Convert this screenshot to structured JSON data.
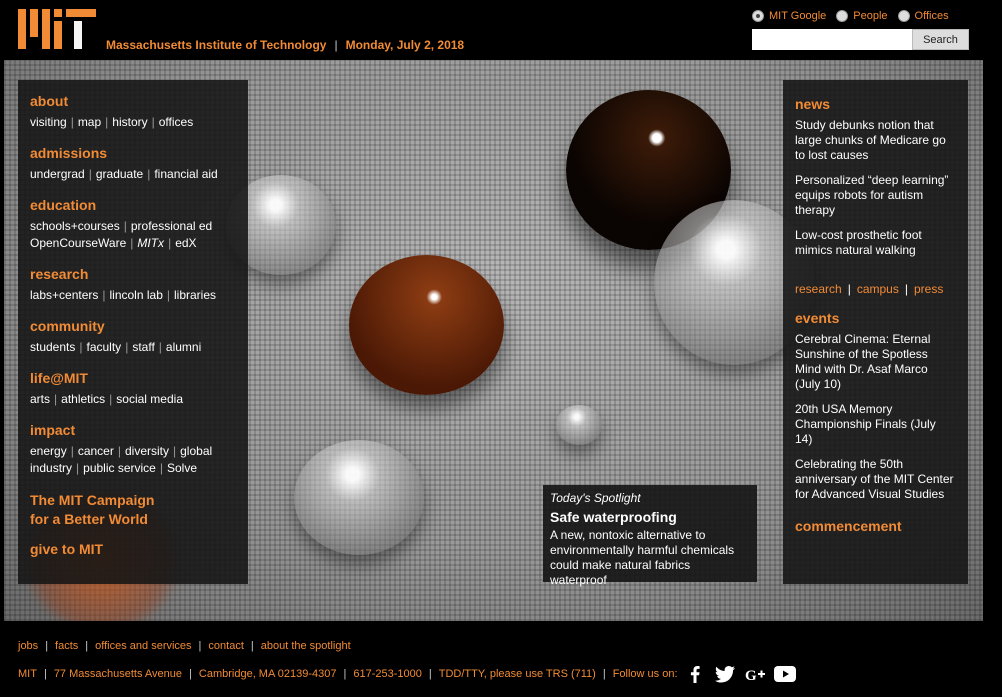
{
  "header": {
    "institute": "Massachusetts Institute of Technology",
    "date": "Monday, July 2, 2018"
  },
  "search": {
    "options": [
      "MIT Google",
      "People",
      "Offices"
    ],
    "selected": "MIT Google",
    "placeholder": "",
    "button_label": "Search"
  },
  "nav": {
    "about": {
      "heading": "about",
      "links": [
        "visiting",
        "map",
        "history",
        "offices"
      ]
    },
    "admissions": {
      "heading": "admissions",
      "links": [
        "undergrad",
        "graduate",
        "financial aid"
      ]
    },
    "education": {
      "heading": "education",
      "links": [
        "schools+courses",
        "professional ed",
        "OpenCourseWare",
        "MITx",
        "edX"
      ]
    },
    "research": {
      "heading": "research",
      "links": [
        "labs+centers",
        "lincoln lab",
        "libraries"
      ]
    },
    "community": {
      "heading": "community",
      "links": [
        "students",
        "faculty",
        "staff",
        "alumni"
      ]
    },
    "life": {
      "heading": "life@MIT",
      "links": [
        "arts",
        "athletics",
        "social media"
      ]
    },
    "impact": {
      "heading": "impact",
      "links": [
        "energy",
        "cancer",
        "diversity",
        "global",
        "industry",
        "public service",
        "Solve"
      ]
    },
    "campaign_line1": "The MIT Campaign",
    "campaign_line2": "for a Better World",
    "give": "give to MIT"
  },
  "news": {
    "heading": "news",
    "items": [
      "Study debunks notion that large chunks of Medicare go to lost causes",
      "Personalized “deep learning” equips robots for autism therapy",
      "Low-cost prosthetic foot mimics natural walking"
    ],
    "links": [
      "research",
      "campus",
      "press"
    ]
  },
  "events": {
    "heading": "events",
    "items": [
      "Cerebral Cinema: Eternal Sunshine of the Spotless Mind with Dr. Asaf Marco (July 10)",
      "20th USA Memory Championship Finals (July 14)",
      "Celebrating the 50th anniversary of the MIT Center for Advanced Visual Studies"
    ]
  },
  "commencement": "commencement",
  "spotlight": {
    "label": "Today's Spotlight",
    "title": "Safe waterproofing",
    "description": "A new, nontoxic alternative to environmentally harmful chemicals could make natural fabrics waterproof"
  },
  "footer": {
    "links": [
      "jobs",
      "facts",
      "offices and services",
      "contact",
      "about the spotlight"
    ],
    "address": [
      "MIT",
      "77 Massachusetts Avenue",
      "Cambridge, MA 02139-4307",
      "617-253-1000",
      "TDD/TTY, please use TRS (711)"
    ],
    "follow_label": "Follow us on:",
    "social": [
      "facebook-icon",
      "twitter-icon",
      "google-plus-icon",
      "youtube-icon"
    ]
  },
  "colors": {
    "accent": "#f28b35",
    "panel": "#141414"
  }
}
